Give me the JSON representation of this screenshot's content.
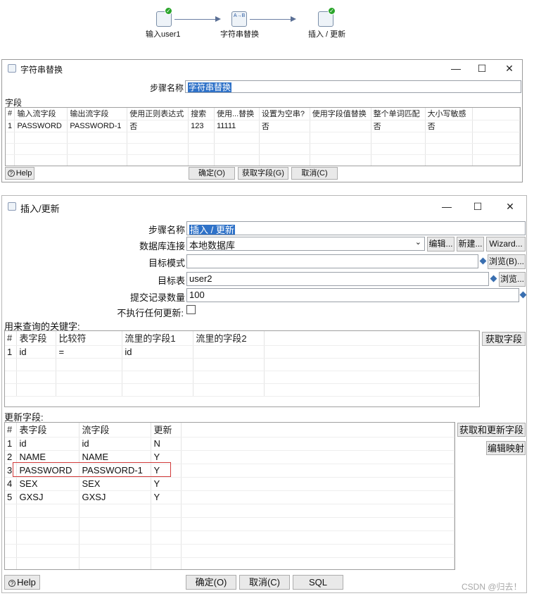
{
  "flow": {
    "nodes": [
      {
        "label": "输入user1",
        "icon": "table-input-icon"
      },
      {
        "label": "字符串替换",
        "icon": "string-replace-icon"
      },
      {
        "label": "插入 / 更新",
        "icon": "insert-update-icon"
      }
    ]
  },
  "dlg1": {
    "title": "字符串替换",
    "step_name_label": "步骤名称",
    "step_name_value": "字符串替换",
    "fields_label": "字段",
    "columns": [
      "#",
      "输入流字段",
      "输出流字段",
      "使用正则表达式",
      "搜索",
      "使用...替换",
      "设置为空串?",
      "使用字段值替换",
      "整个单词匹配",
      "大小写敏感"
    ],
    "rows": [
      [
        "1",
        "PASSWORD",
        "PASSWORD-1",
        "否",
        "123",
        "11111",
        "否",
        "",
        "否",
        "否"
      ]
    ],
    "help": "Help",
    "ok": "确定(O)",
    "get_fields": "获取字段(G)",
    "cancel": "取消(C)"
  },
  "dlg2": {
    "title": "插入/更新",
    "step_name_label": "步骤名称",
    "step_name_value": "插入 / 更新",
    "connection_label": "数据库连接",
    "connection_value": "本地数据库",
    "edit_btn": "编辑...",
    "new_btn": "新建...",
    "wizard_btn": "Wizard...",
    "schema_label": "目标模式",
    "schema_value": "",
    "browse_btn": "浏览(B)...",
    "table_label": "目标表",
    "table_value": "user2",
    "browse_btn2": "浏览...",
    "commit_label": "提交记录数量",
    "commit_value": "100",
    "no_update_label": "不执行任何更新:",
    "keys_label": "用来查询的关键字:",
    "keys_columns": [
      "#",
      "表字段",
      "比较符",
      "流里的字段1",
      "流里的字段2"
    ],
    "keys_rows": [
      [
        "1",
        "id",
        "=",
        "id",
        ""
      ]
    ],
    "get_fields_btn": "获取字段",
    "update_label": "更新字段:",
    "update_columns": [
      "#",
      "表字段",
      "流字段",
      "更新"
    ],
    "update_rows": [
      [
        "1",
        "id",
        "id",
        "N"
      ],
      [
        "2",
        "NAME",
        "NAME",
        "Y"
      ],
      [
        "3",
        "PASSWORD",
        "PASSWORD-1",
        "Y"
      ],
      [
        "4",
        "SEX",
        "SEX",
        "Y"
      ],
      [
        "5",
        "GXSJ",
        "GXSJ",
        "Y"
      ]
    ],
    "get_update_btn": "获取和更新字段",
    "edit_mapping_btn": "编辑映射",
    "help": "Help",
    "ok": "确定(O)",
    "cancel": "取消(C)",
    "sql": "SQL"
  },
  "watermark": "CSDN @归去！",
  "colors": {
    "selection": "#2f72c8",
    "highlight_border": "#d23a3a",
    "success": "#2aa52a"
  }
}
